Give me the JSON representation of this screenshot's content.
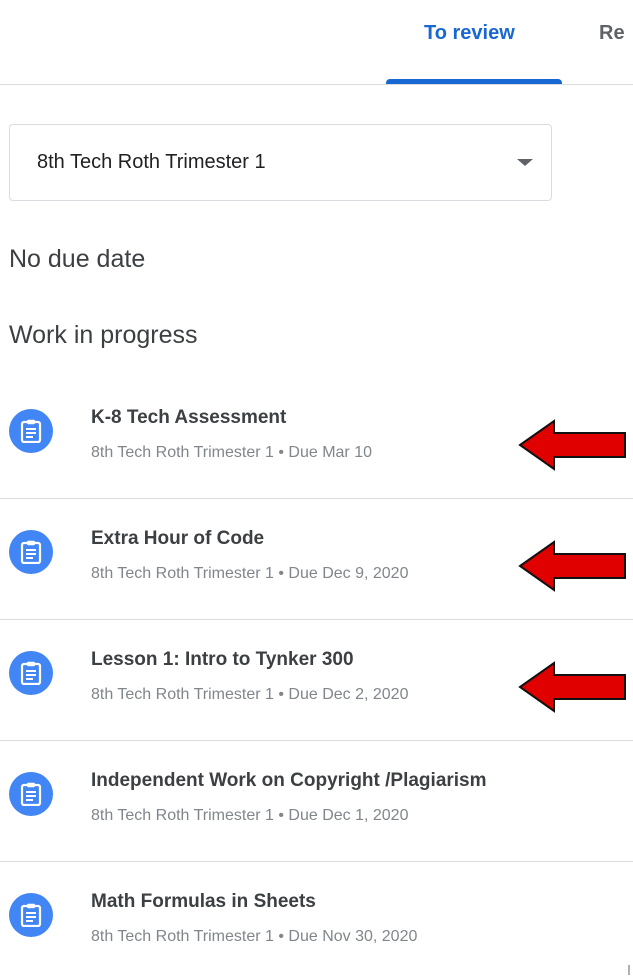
{
  "tabs": {
    "to_review": "To review",
    "returned": "Re"
  },
  "class_select": {
    "value": "8th Tech Roth Trimester 1"
  },
  "sections": {
    "no_due_date": "No due date",
    "work_in_progress": "Work in progress"
  },
  "assignments": [
    {
      "title": "K-8 Tech Assessment",
      "meta": "8th Tech Roth Trimester 1 • Due Mar 10",
      "arrow": true
    },
    {
      "title": "Extra Hour of Code",
      "meta": "8th Tech Roth Trimester 1 • Due Dec 9, 2020",
      "arrow": true
    },
    {
      "title": "Lesson 1: Intro to Tynker 300",
      "meta": "8th Tech Roth Trimester 1 • Due Dec 2, 2020",
      "arrow": true
    },
    {
      "title": "Independent Work on Copyright /Plagiarism",
      "meta": "8th Tech Roth Trimester 1 • Due Dec 1, 2020",
      "arrow": false
    },
    {
      "title": "Math Formulas in Sheets",
      "meta": "8th Tech Roth Trimester 1 • Due Nov 30, 2020",
      "arrow": false
    }
  ],
  "colors": {
    "accent": "#1967d2",
    "icon_bg": "#4285f4",
    "arrow_fill": "#e00000"
  },
  "icons": {
    "assignment": "assignment-icon",
    "dropdown": "dropdown-arrow-icon",
    "annotation": "red-arrow-icon"
  }
}
